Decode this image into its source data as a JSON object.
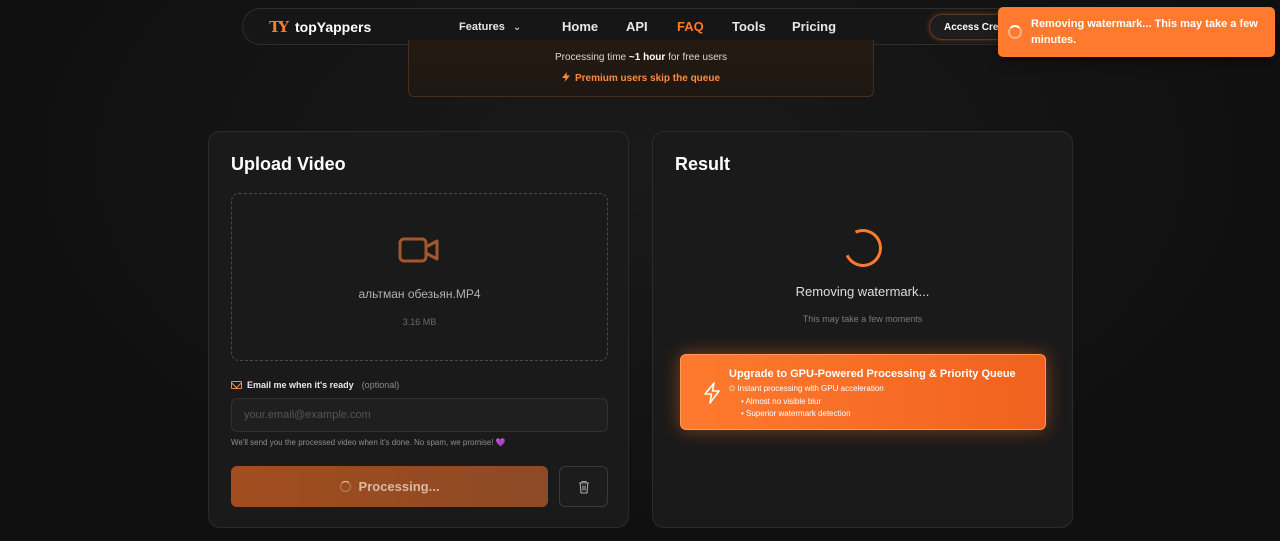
{
  "nav": {
    "logo_text": "topYappers",
    "logo_mark": "TY",
    "features_label": "Features",
    "home_label": "Home",
    "api_label": "API",
    "faq_label": "FAQ",
    "tools_label": "Tools",
    "pricing_label": "Pricing",
    "access_label": "Access Creat"
  },
  "banner": {
    "processing_prefix": "Processing time ",
    "processing_time": "~1 hour",
    "processing_suffix": " for free users",
    "premium_text": "Premium users skip the queue"
  },
  "toast": {
    "message": "Removing watermark... This may take a few minutes."
  },
  "upload": {
    "title": "Upload Video",
    "file_name": "альтман обезьян.MP4",
    "file_size": "3.16 MB",
    "email_label": "Email me when it's ready",
    "email_optional": "(optional)",
    "email_placeholder": "your.email@example.com",
    "email_note": "We'll send you the processed video when it's done. No spam, we promise! 💜",
    "process_label": "Processing..."
  },
  "result": {
    "title": "Result",
    "status": "Removing watermark...",
    "sub": "This may take a few moments",
    "upgrade_title": "Upgrade to GPU-Powered Processing & Priority Queue",
    "upgrade_line1": "⏲ Instant processing with GPU acceleration",
    "upgrade_line2": "• Almost no visible blur",
    "upgrade_line3": "• Superior watermark detection"
  },
  "colors": {
    "accent": "#ff7a2e",
    "background": "#111111",
    "card": "#1a1a1a"
  },
  "icons": [
    "logo-icon",
    "chevron-down-icon",
    "bolt-icon",
    "video-camera-icon",
    "mail-icon",
    "spinner-icon",
    "trash-icon"
  ]
}
